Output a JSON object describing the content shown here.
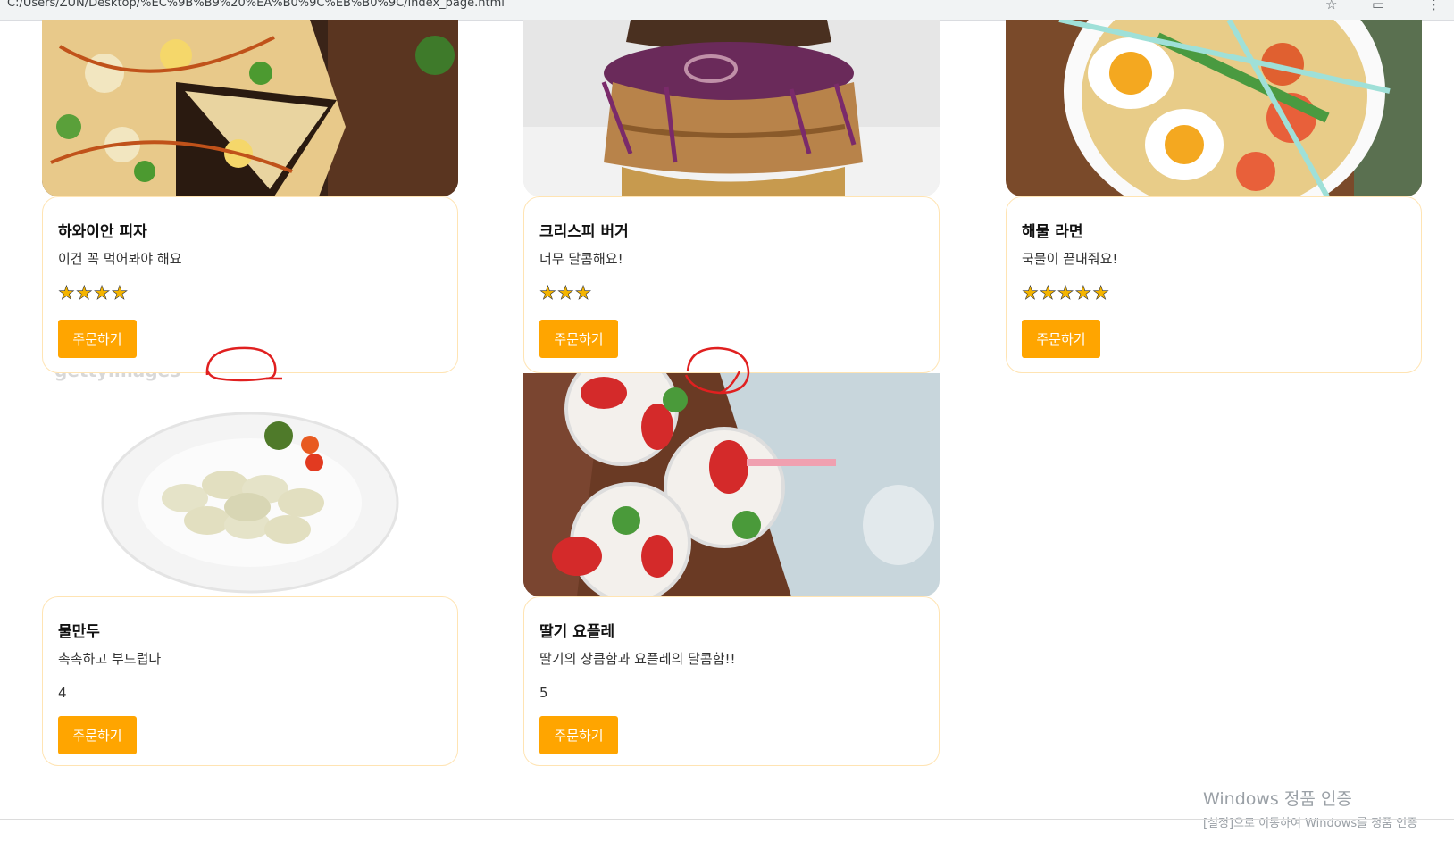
{
  "browser": {
    "address": "C:/Users/ZUN/Desktop/%EC%9B%B9%20%EA%B0%9C%EB%B0%9C/index_page.html"
  },
  "cards": [
    {
      "name": "하와이안 피자",
      "desc": "이건 꼭 먹어봐야 해요",
      "rating_display": "stars",
      "rating": 4,
      "stars": "★★★★",
      "button": "주문하기"
    },
    {
      "name": "크리스피 버거",
      "desc": "너무 달콤해요!",
      "rating_display": "stars",
      "rating": 3,
      "stars": "★★★",
      "button": "주문하기"
    },
    {
      "name": "해물 라면",
      "desc": "국물이 끝내줘요!",
      "rating_display": "stars",
      "rating": 5,
      "stars": "★★★★★",
      "button": "주문하기"
    },
    {
      "name": "물만두",
      "desc": "촉촉하고 부드럽다",
      "rating_display": "number",
      "rating_text": "4",
      "button": "주문하기"
    },
    {
      "name": "딸기 요플레",
      "desc": "딸기의 상큼함과 요플레의 달콤함!!",
      "rating_display": "number",
      "rating_text": "5",
      "button": "주문하기"
    }
  ],
  "watermark": {
    "line1": "Windows 정품 인증",
    "line2": "[설정]으로 이동하여 Windows를 정품 인증"
  },
  "colors": {
    "accent": "#ffa500",
    "card_border": "#ffe4b3",
    "annotation": "#e02020"
  }
}
